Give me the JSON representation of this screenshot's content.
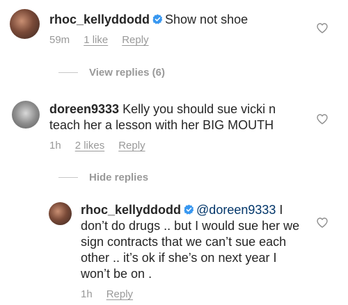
{
  "comments": [
    {
      "username": "rhoc_kellyddodd",
      "verified": true,
      "text": "Show not shoe",
      "time": "59m",
      "likes": "1 like",
      "reply": "Reply"
    },
    {
      "username": "doreen9333",
      "verified": false,
      "text": "Kelly you should sue vicki n teach her a lesson with her BIG MOUTH",
      "time": "1h",
      "likes": "2 likes",
      "reply": "Reply"
    }
  ],
  "view_replies": "View replies (6)",
  "hide_replies": "Hide replies",
  "reply": {
    "username": "rhoc_kellyddodd",
    "verified": true,
    "mention": "@doreen9333",
    "text": "I don’t do drugs .. but I would sue her we sign contracts that we can’t sue each other .. it’s ok if she’s on next year I won’t be on .",
    "time": "1h",
    "reply": "Reply"
  },
  "colors": {
    "text": "#262626",
    "muted": "#999999",
    "verified": "#3897f0",
    "mention": "#003569"
  },
  "icons": [
    "verified-badge-icon",
    "heart-icon"
  ]
}
